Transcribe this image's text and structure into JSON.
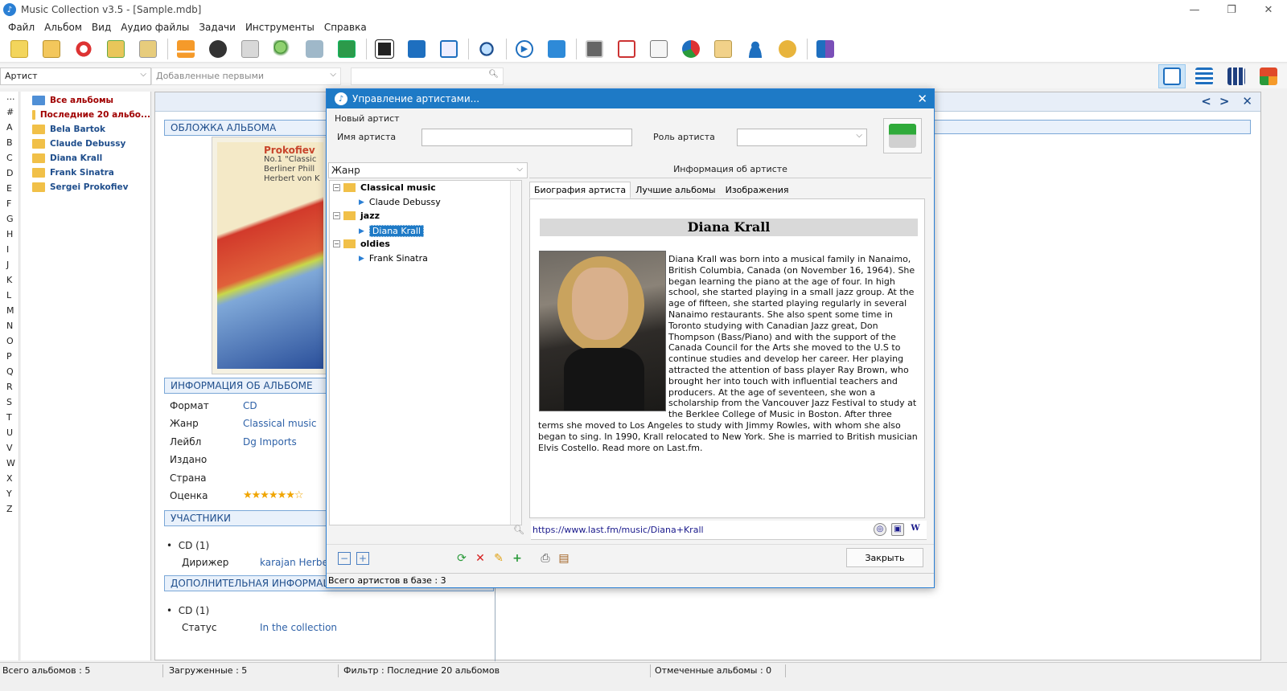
{
  "window": {
    "title": "Music Collection v3.5 - [Sample.mdb]"
  },
  "menu": [
    "Файл",
    "Альбом",
    "Вид",
    "Аудио файлы",
    "Задачи",
    "Инструменты",
    "Справка"
  ],
  "toolbar": {
    "icons": [
      "add-album-icon",
      "add-folder-icon",
      "lifebuoy-icon",
      "find-album-icon",
      "scan-icon",
      "eject-icon",
      "text-disc-icon",
      "download-icon",
      "search-icon",
      "disc-search-icon",
      "add-note-icon",
      "film-icon",
      "edit-icon",
      "browse-icon",
      "zoom-icon",
      "play-icon",
      "shuffle-icon",
      "print-icon",
      "calendar-icon",
      "document-icon",
      "chart-icon",
      "archive-icon",
      "user-icon",
      "tools-icon",
      "exit-icon"
    ]
  },
  "filter": {
    "group_by": "Артист",
    "sort_by": "Добавленные первыми"
  },
  "letters": [
    "...",
    "#",
    "A",
    "B",
    "C",
    "D",
    "E",
    "F",
    "G",
    "H",
    "I",
    "J",
    "K",
    "L",
    "M",
    "N",
    "O",
    "P",
    "Q",
    "R",
    "S",
    "T",
    "U",
    "V",
    "W",
    "X",
    "Y",
    "Z"
  ],
  "album_tree": [
    {
      "label": "Все альбомы",
      "style": "red",
      "folder": "blue"
    },
    {
      "label": "Последние 20 альбо...",
      "style": "red",
      "folder": "yellow"
    },
    {
      "label": "Bela Bartok",
      "style": "blue",
      "folder": "yellow"
    },
    {
      "label": "Claude Debussy",
      "style": "blue",
      "folder": "yellow"
    },
    {
      "label": "Diana Krall",
      "style": "blue",
      "folder": "yellow"
    },
    {
      "label": "Frank Sinatra",
      "style": "blue",
      "folder": "yellow"
    },
    {
      "label": "Sergei Prokofiev",
      "style": "blue",
      "folder": "yellow"
    }
  ],
  "main": {
    "cover_section": "ОБЛОЖКА АЛЬБОМА",
    "cover_title_lines": [
      "Prokofiev",
      "No.1 \"Classic",
      "Berliner Phill",
      "Herbert von K"
    ],
    "info_section": "ИНФОРМАЦИЯ ОБ АЛЬБОМЕ",
    "info": {
      "format_label": "Формат",
      "format_value": "CD",
      "genre_label": "Жанр",
      "genre_value": "Classical music",
      "label_label": "Лейбл",
      "label_value": "Dg Imports",
      "published_label": "Издано",
      "country_label": "Страна",
      "rating_label": "Оценка",
      "rating_value": "★★★★★★☆"
    },
    "participants_section": "УЧАСТНИКИ",
    "participants": {
      "disc": "CD (1)",
      "role": "Дирижер",
      "name": "karajan Herbe"
    },
    "extra_section": "ДОПОЛНИТЕЛЬНАЯ ИНФОРМАЦ",
    "extra": {
      "disc": "CD (1)",
      "status_label": "Статус",
      "status_value": "In the collection"
    }
  },
  "dialog": {
    "title": "Управление артистами...",
    "new_artist": "Новый артист",
    "artist_name_label": "Имя артиста",
    "artist_role_label": "Роль артиста",
    "genre_combo": "Жанр",
    "tree": {
      "g1": "Classical music",
      "g1a": "Claude Debussy",
      "g2": "jazz",
      "g2a": "Diana Krall",
      "g3": "oldies",
      "g3a": "Frank Sinatra"
    },
    "info_header": "Информация об артисте",
    "tabs": [
      "Биография артиста",
      "Лучшие альбомы",
      "Изображения"
    ],
    "bio_name": "Diana Krall",
    "bio_text": "Diana Krall was born into a musical family in Nanaimo, British Columbia, Canada (on November 16, 1964). She began learning the piano at the age of four. In high school, she started playing in a small jazz group. At the age of fifteen, she started playing regularly in several Nanaimo restaurants. She also spent some time in Toronto studying with Canadian Jazz great, Don Thompson (Bass/Piano) and with the support of the Canada Council for the Arts she moved to the U.S to continue studies and develop her career. Her playing attracted the attention of bass player Ray Brown, who brought her into touch with influential teachers and producers. At the age of seventeen, she won a scholarship from the Vancouver Jazz Festival to study at the Berklee College of Music in Boston. After three terms she moved to Los Angeles to study with Jimmy Rowles, with whom she also began to sing. In 1990, Krall relocated to New York. She is married to British musician Elvis Costello. Read more on Last.fm.",
    "url": "https://www.last.fm/music/Diana+Krall",
    "close_button": "Закрыть",
    "status": "Всего артистов в базе : 3"
  },
  "statusbar": {
    "total": "Всего альбомов : 5",
    "loaded": "Загруженные : 5",
    "filter": "Фильтр : Последние 20 альбомов",
    "marked": "Отмеченные альбомы : 0"
  },
  "colors": {
    "accent": "#1e7ac6",
    "link": "#2f62a8",
    "tree_blue": "#1f4e8c",
    "tree_red": "#a00000"
  }
}
